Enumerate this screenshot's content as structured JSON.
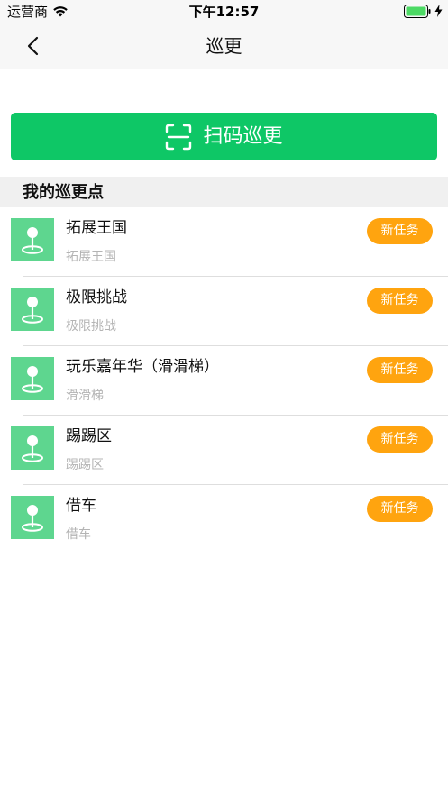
{
  "status_bar": {
    "carrier": "运营商",
    "time": "下午12:57",
    "wifi_icon": "wifi-icon",
    "battery_icon": "battery-icon",
    "charging_icon": "charging-bolt-icon",
    "battery_color": "#4cd964"
  },
  "nav": {
    "title": "巡更",
    "back_icon": "chevron-left-icon"
  },
  "scan_button": {
    "label": "扫码巡更",
    "icon": "scan-icon",
    "color": "#0ec766"
  },
  "section": {
    "title": "我的巡更点"
  },
  "patrol_points": [
    {
      "name": "拓展王国",
      "description": "拓展王国",
      "badge": "新任务"
    },
    {
      "name": "极限挑战",
      "description": "极限挑战",
      "badge": "新任务"
    },
    {
      "name": "玩乐嘉年华（滑滑梯）",
      "description": "滑滑梯",
      "badge": "新任务"
    },
    {
      "name": "踢踢区",
      "description": "踢踢区",
      "badge": "新任务"
    },
    {
      "name": "借车",
      "description": "借车",
      "badge": "新任务"
    }
  ],
  "colors": {
    "accent_green": "#0ec766",
    "icon_green": "#5ed68f",
    "badge_orange": "#ffa40f"
  }
}
